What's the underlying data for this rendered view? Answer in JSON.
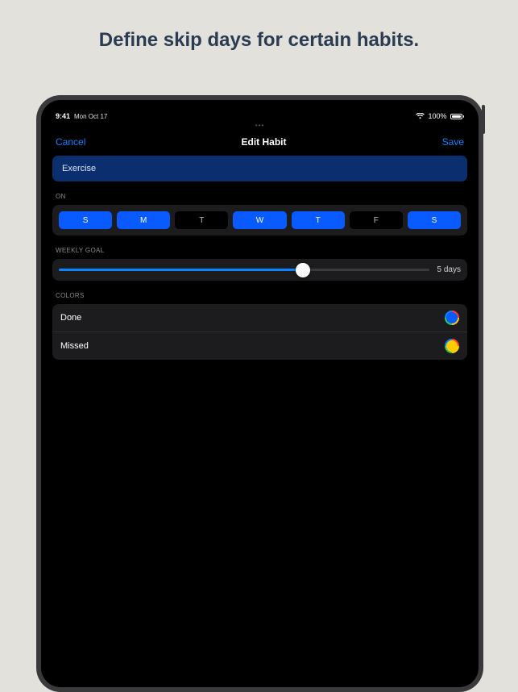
{
  "marketing": {
    "headline": "Define skip days for certain habits."
  },
  "status": {
    "time": "9:41",
    "date": "Mon Oct 17",
    "battery_pct": "100%"
  },
  "nav": {
    "cancel": "Cancel",
    "title": "Edit Habit",
    "save": "Save"
  },
  "habit": {
    "name": "Exercise"
  },
  "sections": {
    "on": "ON",
    "weekly_goal": "WEEKLY GOAL",
    "colors": "COLORS"
  },
  "days": [
    {
      "label": "S",
      "active": true
    },
    {
      "label": "M",
      "active": true
    },
    {
      "label": "T",
      "active": false
    },
    {
      "label": "W",
      "active": true
    },
    {
      "label": "T",
      "active": true
    },
    {
      "label": "F",
      "active": false
    },
    {
      "label": "S",
      "active": true
    }
  ],
  "slider": {
    "value_label": "5 days",
    "fill_pct": 66
  },
  "colors": {
    "done": {
      "label": "Done",
      "fill": "#0a5bff"
    },
    "missed": {
      "label": "Missed",
      "fill": "#ffcc00"
    }
  }
}
